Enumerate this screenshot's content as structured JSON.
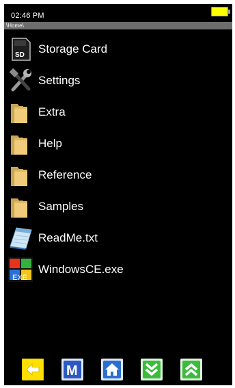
{
  "status": {
    "time": "02:46 PM",
    "battery_color": "#ffff00"
  },
  "path": "\\Home\\",
  "files": [
    {
      "label": "Storage Card",
      "icon": "sd-card-icon"
    },
    {
      "label": "Settings",
      "icon": "tools-icon"
    },
    {
      "label": "Extra",
      "icon": "folder-icon"
    },
    {
      "label": "Help",
      "icon": "folder-icon"
    },
    {
      "label": "Reference",
      "icon": "folder-icon"
    },
    {
      "label": "Samples",
      "icon": "folder-icon"
    },
    {
      "label": "ReadMe.txt",
      "icon": "notepad-icon"
    },
    {
      "label": "WindowsCE.exe",
      "icon": "exe-icon"
    }
  ],
  "sd_card_text": "SD",
  "exe_text": "EXE",
  "toolbar": {
    "menu_label": "M",
    "buttons": [
      {
        "name": "back",
        "color": "#ffe000"
      },
      {
        "name": "menu",
        "color": "#2b59c3"
      },
      {
        "name": "home",
        "color": "#2b6fd1"
      },
      {
        "name": "page-down",
        "color": "#3dbb3d"
      },
      {
        "name": "page-up",
        "color": "#3dbb3d"
      }
    ]
  }
}
